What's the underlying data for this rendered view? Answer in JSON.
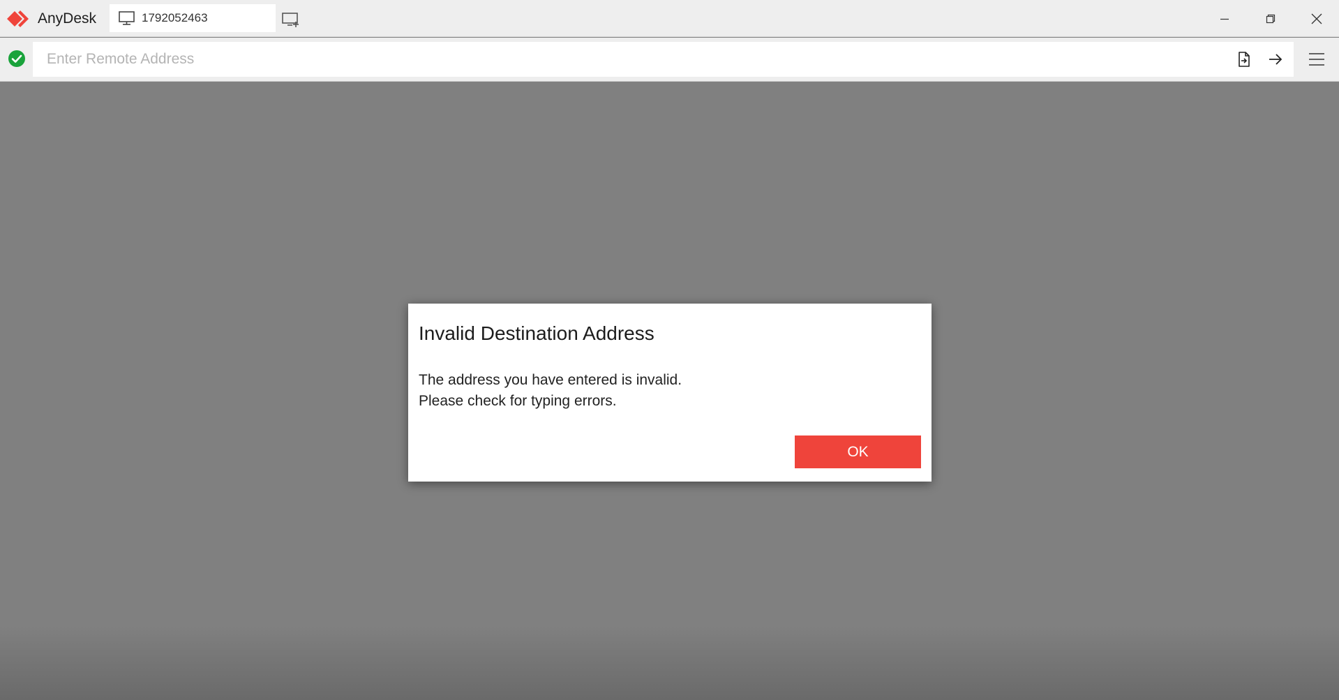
{
  "app": {
    "name": "AnyDesk",
    "brand_color": "#ef443b"
  },
  "tab": {
    "id": "1792052463",
    "icon": "monitor-icon"
  },
  "address_bar": {
    "placeholder": "Enter Remote Address",
    "value": "",
    "status_icon": "check-circle-icon",
    "status_color": "#1aa33b"
  },
  "dialog": {
    "title": "Invalid Destination Address",
    "message_line1": "The address you have entered is invalid.",
    "message_line2": "Please check for typing errors.",
    "ok_label": "OK"
  }
}
